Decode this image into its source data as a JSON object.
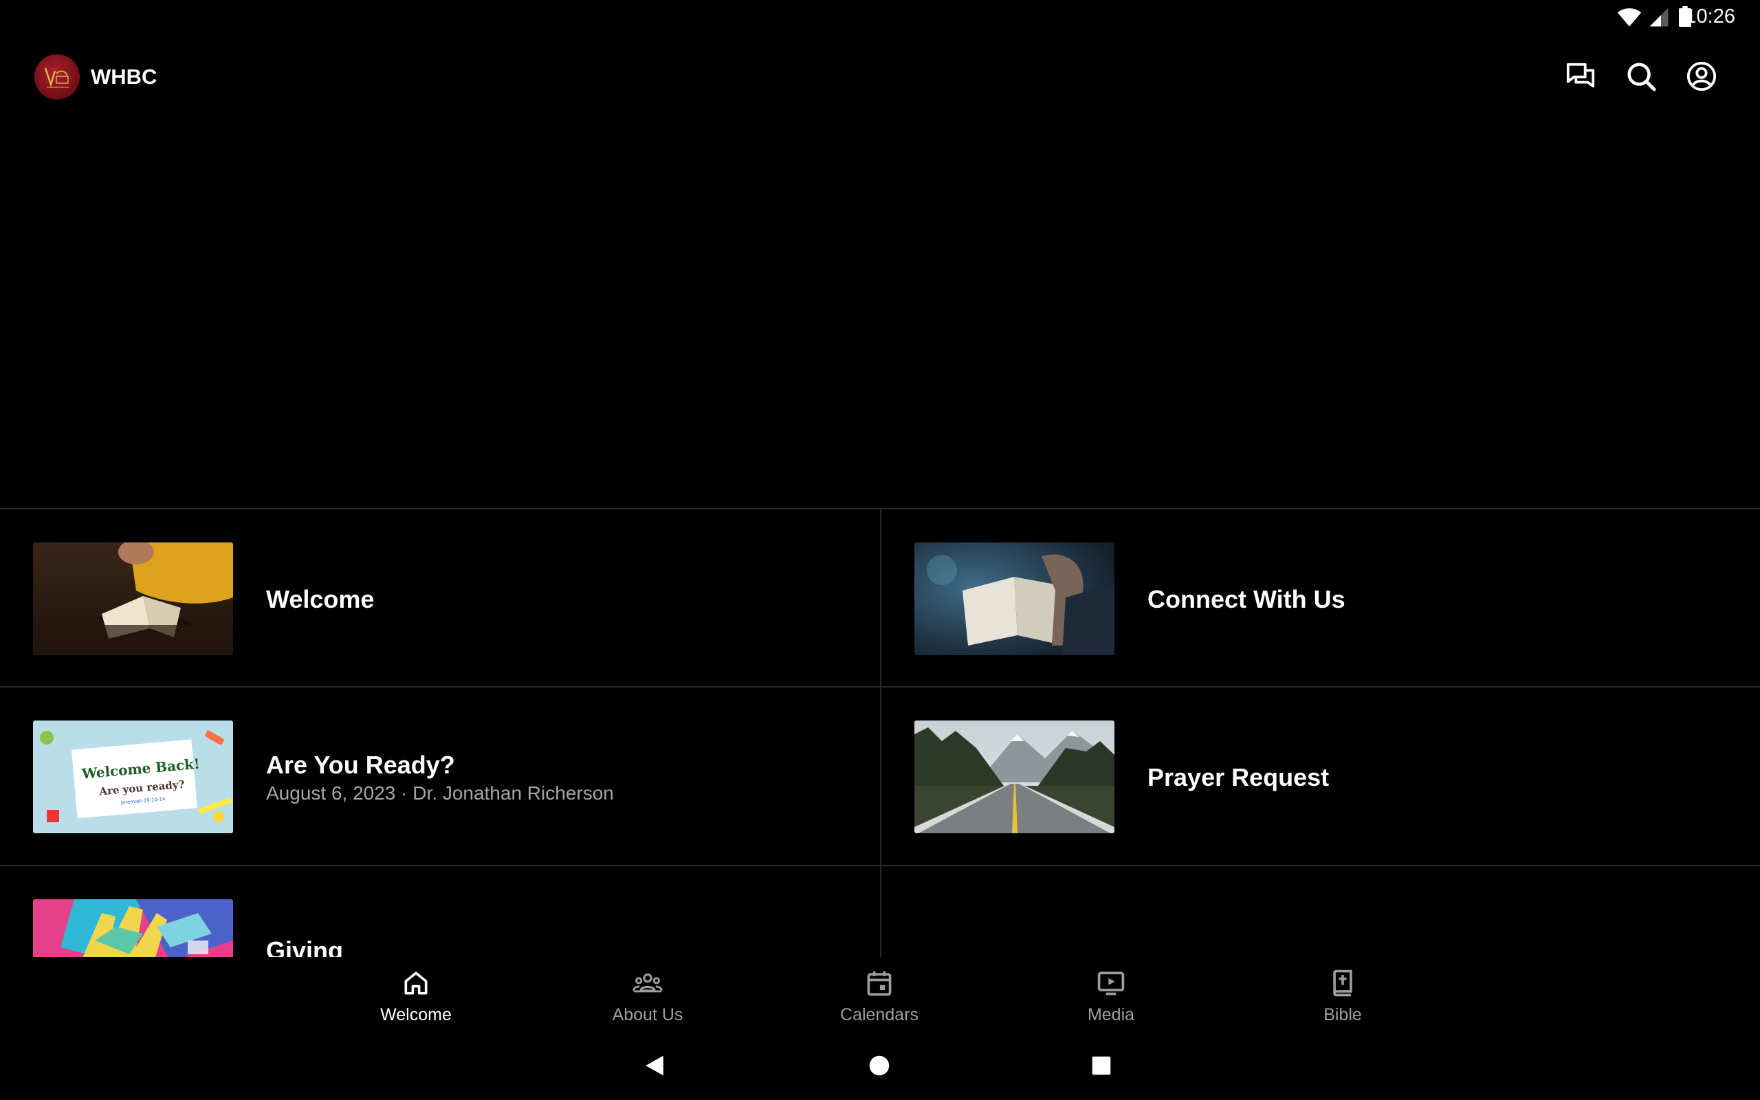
{
  "status_bar": {
    "time": "10:26"
  },
  "app_bar": {
    "title": "WHBC",
    "icons": [
      "chat-icon",
      "search-icon",
      "account-icon"
    ]
  },
  "cards": [
    {
      "title": "Welcome",
      "subtitle": ""
    },
    {
      "title": "Connect With Us",
      "subtitle": ""
    },
    {
      "title": "Are You Ready?",
      "subtitle": "August 6, 2023 · Dr. Jonathan Richerson",
      "thumb_text": {
        "line1": "Welcome Back!",
        "line2": "Are you ready?",
        "line3": "Jeremiah 29:10-14"
      }
    },
    {
      "title": "Prayer Request",
      "subtitle": ""
    },
    {
      "title": "Giving",
      "subtitle": ""
    }
  ],
  "bottom_nav": [
    {
      "label": "Welcome",
      "icon": "home-icon",
      "active": true
    },
    {
      "label": "About Us",
      "icon": "group-icon",
      "active": false
    },
    {
      "label": "Calendars",
      "icon": "calendar-icon",
      "active": false
    },
    {
      "label": "Media",
      "icon": "media-icon",
      "active": false
    },
    {
      "label": "Bible",
      "icon": "bible-icon",
      "active": false
    }
  ],
  "colors": {
    "background": "#000000",
    "divider": "#2a2a2a",
    "text_primary": "#ffffff",
    "text_secondary": "#a6a6a6",
    "logo_red": "#8c1520"
  }
}
